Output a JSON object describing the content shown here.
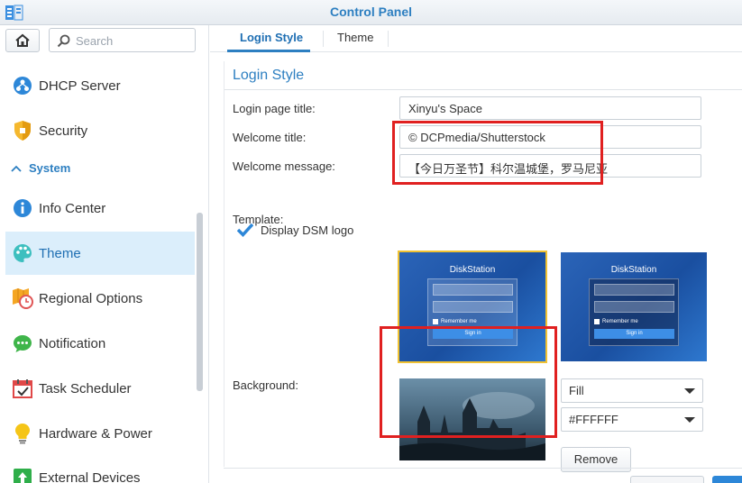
{
  "window": {
    "title": "Control Panel"
  },
  "colors": {
    "accent": "#2d7fc1",
    "highlight": "#e02020",
    "selected_template_border": "#f1c232"
  },
  "search": {
    "placeholder": "Search"
  },
  "sidebar": {
    "items": [
      {
        "label": "DHCP Server",
        "icon": "dhcp-icon"
      },
      {
        "label": "Security",
        "icon": "shield-icon"
      }
    ],
    "section": {
      "label": "System",
      "icon": "chevron-up-icon"
    },
    "system_items": [
      {
        "label": "Info Center",
        "icon": "info-icon"
      },
      {
        "label": "Theme",
        "icon": "palette-icon",
        "active": true
      },
      {
        "label": "Regional Options",
        "icon": "map-clock-icon"
      },
      {
        "label": "Notification",
        "icon": "chat-bubble-icon"
      },
      {
        "label": "Task Scheduler",
        "icon": "calendar-check-icon"
      },
      {
        "label": "Hardware & Power",
        "icon": "lightbulb-icon"
      },
      {
        "label": "External Devices",
        "icon": "upload-icon"
      }
    ]
  },
  "tabs": [
    {
      "label": "Login Style",
      "active": true
    },
    {
      "label": "Theme",
      "active": false
    }
  ],
  "login_style": {
    "heading": "Login Style",
    "login_page_title": {
      "label": "Login page title:",
      "value": "Xinyu's Space"
    },
    "welcome_title": {
      "label": "Welcome title:",
      "value": "© DCPmedia/Shutterstock"
    },
    "welcome_message": {
      "label": "Welcome message:",
      "value": "【今日万圣节】科尔温城堡，罗马尼亚"
    },
    "display_logo": {
      "label": "Display DSM logo",
      "checked": true
    },
    "template": {
      "label": "Template:",
      "options": [
        {
          "title": "DiskStation",
          "remember": "Remember me",
          "button": "Sign in",
          "selected": true
        },
        {
          "title": "DiskStation",
          "remember": "Remember me",
          "button": "Sign in",
          "selected": false
        }
      ]
    },
    "background": {
      "label": "Background:",
      "fill_mode": "Fill",
      "color": "#FFFFFF",
      "remove_label": "Remove"
    }
  }
}
